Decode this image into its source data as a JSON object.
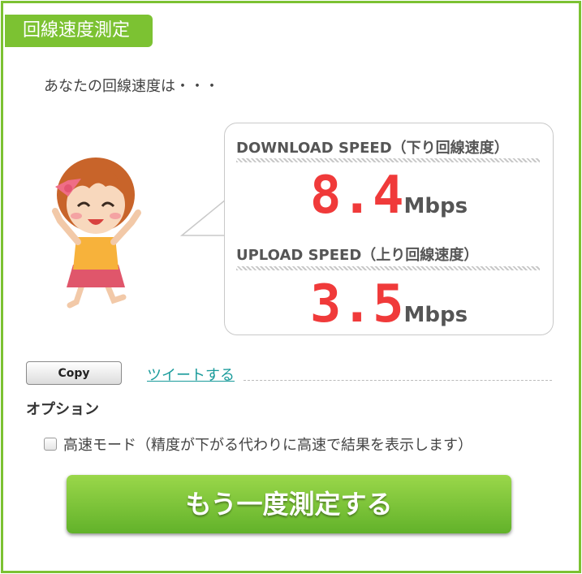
{
  "header": {
    "title": "回線速度測定"
  },
  "intro": {
    "text": "あなたの回線速度は・・・"
  },
  "results": {
    "download": {
      "label": "DOWNLOAD SPEED（下り回線速度）",
      "value": "8.4",
      "unit": "Mbps"
    },
    "upload": {
      "label": "UPLOAD SPEED（上り回線速度）",
      "value": "3.5",
      "unit": "Mbps"
    }
  },
  "actions": {
    "copy_label": "Copy",
    "tweet_label": "ツイートする",
    "retest_label": "もう一度測定する"
  },
  "options": {
    "heading": "オプション",
    "fast_mode_label": "高速モード（精度が下がる代わりに高速で結果を表示します）",
    "fast_mode_checked": false
  },
  "colors": {
    "accent": "#7cc232",
    "speed": "#f03a3a",
    "link": "#1a9b9b"
  }
}
